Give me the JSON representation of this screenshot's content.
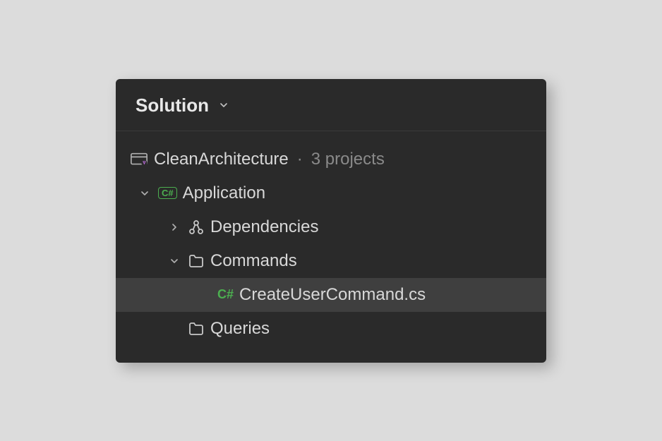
{
  "header": {
    "title": "Solution"
  },
  "solution": {
    "name": "CleanArchitecture",
    "project_count_label": "3 projects"
  },
  "tree": {
    "application": {
      "label": "Application",
      "badge": "C#"
    },
    "dependencies": {
      "label": "Dependencies"
    },
    "commands": {
      "label": "Commands"
    },
    "createUser": {
      "label": "CreateUserCommand.cs",
      "badge": "C#"
    },
    "queries": {
      "label": "Queries"
    }
  }
}
